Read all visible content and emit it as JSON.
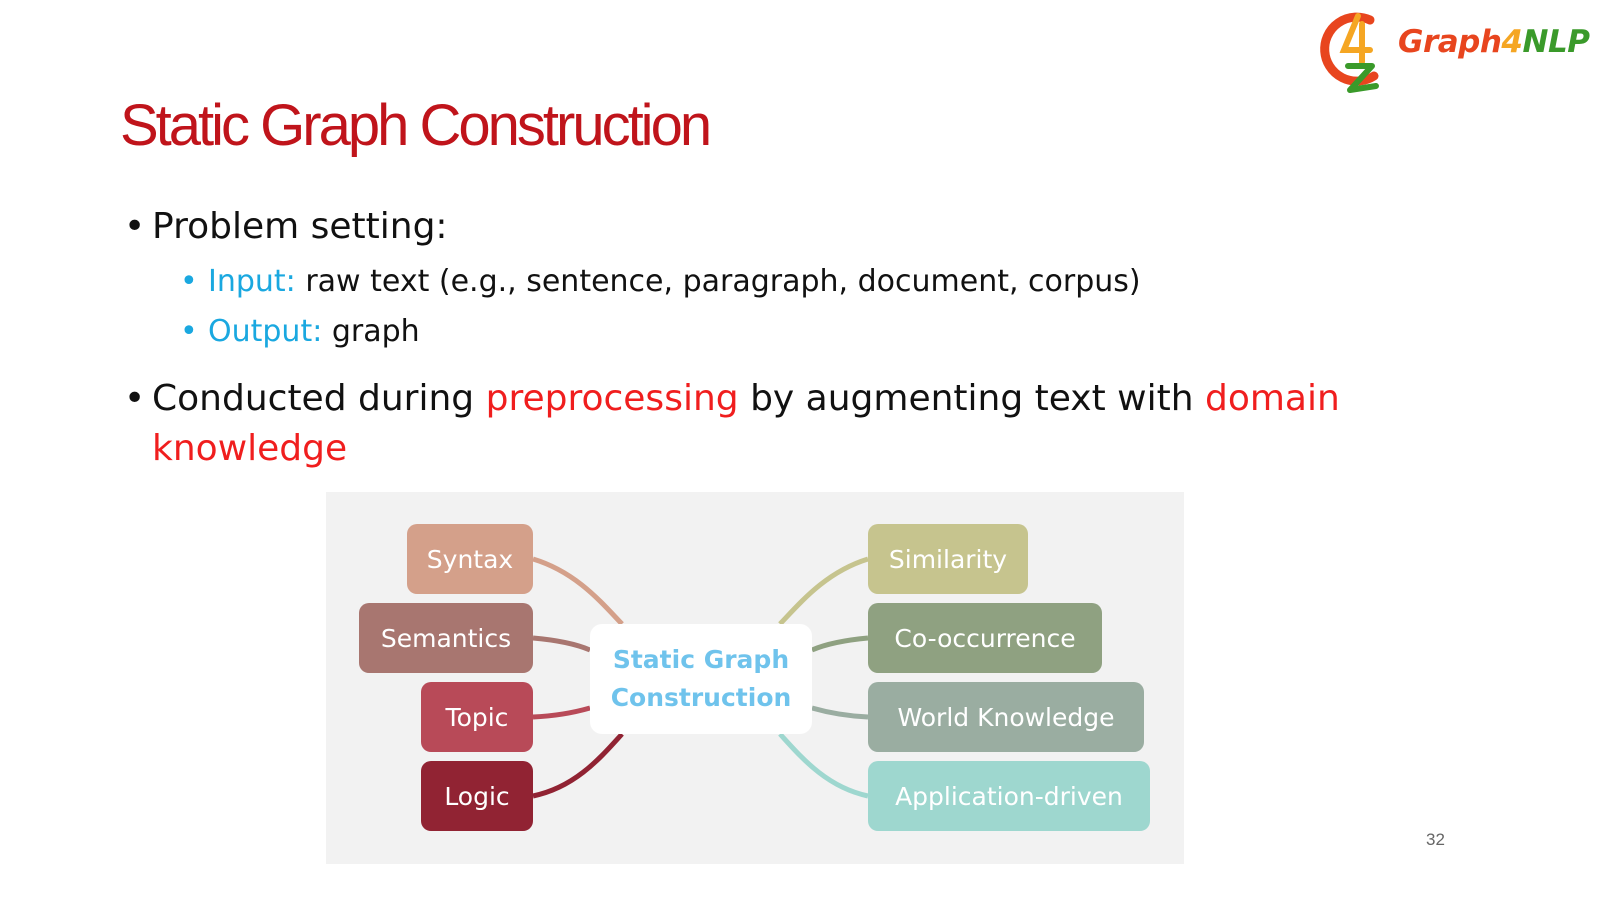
{
  "logo": {
    "brand_a": "Graph",
    "brand_b": "4",
    "brand_c": "NLP",
    "colors": {
      "red": "#e8451e",
      "orange": "#f5a623",
      "green": "#3a9a2a"
    }
  },
  "slide": {
    "title": "Static Graph Construction",
    "title_color": "#c0141b",
    "page_number": "32"
  },
  "bullets": {
    "b1": {
      "text": "Problem setting:"
    },
    "input": {
      "label": "Input:",
      "text": " raw text (e.g., sentence, paragraph, document, corpus)"
    },
    "output": {
      "label": "Output:",
      "text": " graph"
    },
    "b2": {
      "part1": "Conducted during ",
      "highlight1": "preprocessing",
      "part2": " by augmenting text with ",
      "highlight2": "domain",
      "line2": "knowledge"
    },
    "accent_color": "#1aa8e0",
    "highlight_color": "#f01e1e"
  },
  "diagram": {
    "center_line1": "Static Graph",
    "center_line2": "Construction",
    "left_nodes": [
      {
        "label": "Syntax",
        "color": "#d4a08a"
      },
      {
        "label": "Semantics",
        "color": "#a87670"
      },
      {
        "label": "Topic",
        "color": "#b84a58"
      },
      {
        "label": "Logic",
        "color": "#912333"
      }
    ],
    "right_nodes": [
      {
        "label": "Similarity",
        "color": "#c6c48e"
      },
      {
        "label": "Co-occurrence",
        "color": "#8fa181"
      },
      {
        "label": "World Knowledge",
        "color": "#9aada1"
      },
      {
        "label": "Application-driven",
        "color": "#9ed7cf"
      }
    ]
  }
}
